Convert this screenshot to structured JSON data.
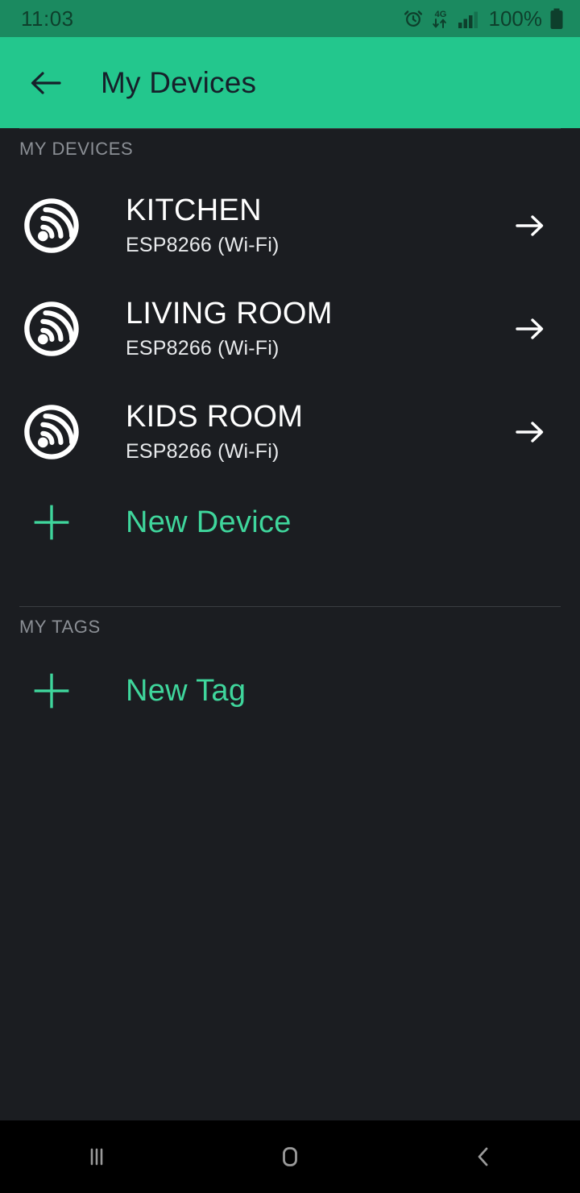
{
  "status_bar": {
    "time": "11:03",
    "battery_percent": "100%",
    "icons": [
      "alarm-icon",
      "4g-data-icon",
      "signal-bars-icon",
      "battery-icon"
    ],
    "network_label": "4G",
    "background_color": "#1b8a60",
    "text_color": "#0e3f2c"
  },
  "app_bar": {
    "title": "My Devices",
    "back_icon": "arrow-left-icon",
    "background_color": "#23c78d",
    "text_color": "#16202a"
  },
  "sections": {
    "devices": {
      "label": "MY DEVICES",
      "items": [
        {
          "name": "KITCHEN",
          "subtitle": "ESP8266 (Wi-Fi)",
          "icon": "espressif-logo-icon",
          "chevron": "arrow-right-icon"
        },
        {
          "name": "LIVING ROOM",
          "subtitle": "ESP8266 (Wi-Fi)",
          "icon": "espressif-logo-icon",
          "chevron": "arrow-right-icon"
        },
        {
          "name": "KIDS ROOM",
          "subtitle": "ESP8266 (Wi-Fi)",
          "icon": "espressif-logo-icon",
          "chevron": "arrow-right-icon"
        }
      ],
      "add_label": "New Device",
      "add_icon": "plus-icon"
    },
    "tags": {
      "label": "MY TAGS",
      "items": [],
      "add_label": "New Tag",
      "add_icon": "plus-icon"
    }
  },
  "nav_bar": {
    "recents": "recents-icon",
    "home": "home-icon",
    "back": "back-icon",
    "background_color": "#000000",
    "icon_color": "#9a9a9a"
  },
  "theme": {
    "background": "#1b1d21",
    "accent_green": "#3fd69c",
    "divider": "#3a3d42",
    "section_label": "#8b8f95"
  }
}
